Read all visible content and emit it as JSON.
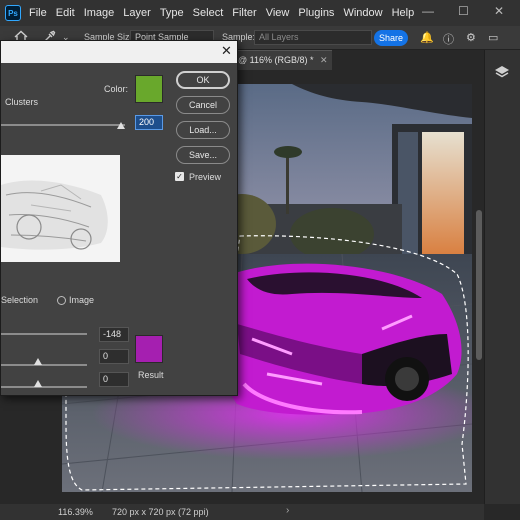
{
  "menubar": {
    "logo": "Ps",
    "items": [
      "File",
      "Edit",
      "Image",
      "Layer",
      "Type",
      "Select",
      "Filter",
      "View",
      "Plugins",
      "Window",
      "Help"
    ],
    "window_controls": [
      "—",
      "☐",
      "✕"
    ]
  },
  "options_bar": {
    "sample_size_label": "Sample Size:",
    "sample_size_value": "Point Sample",
    "sample_label": "Sample:",
    "sample_value": "All Layers",
    "share_label": "Share"
  },
  "document_tab": {
    "title": "@ 116% (RGB/8) *",
    "close": "✕"
  },
  "dialog": {
    "close": "✕",
    "clusters_label": "Clusters",
    "color_label": "Color:",
    "color_swatch": "#69a82c",
    "fuzziness_value": "200",
    "buttons": {
      "ok": "OK",
      "cancel": "Cancel",
      "load": "Load...",
      "save": "Save..."
    },
    "preview_label": "Preview",
    "preview_checked": true,
    "selection_label": "Selection",
    "image_label": "Image",
    "hue_value": "-148",
    "saturation_value": "0",
    "lightness_value": "0",
    "result_label": "Result",
    "result_swatch": "#a51fb0"
  },
  "statusbar": {
    "zoom": "116.39%",
    "doc_info": "720 px x 720 px (72 ppi)",
    "arrow": "›"
  },
  "colors": {
    "accent": "#1473e6",
    "canvas_magenta": "#d21fe0"
  }
}
